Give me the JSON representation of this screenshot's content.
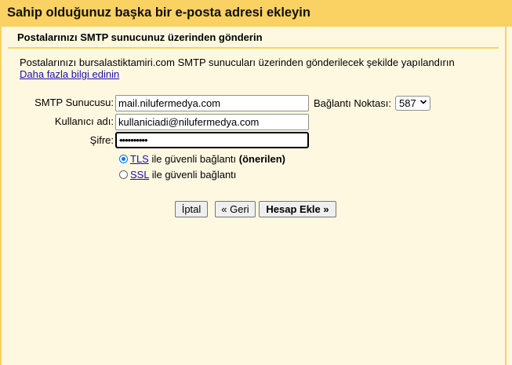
{
  "dialog": {
    "title": "Sahip olduğunuz başka bir e-posta adresi ekleyin",
    "subtitle": "Postalarınızı SMTP sunucunuz üzerinden gönderin",
    "description": "Postalarınızı bursalastiktamiri.com SMTP sunucuları üzerinden gönderilecek şekilde yapılandırın",
    "more_info_link": "Daha fazla bilgi edinin"
  },
  "form": {
    "smtp_label": "SMTP Sunucusu:",
    "smtp_value": "mail.nilufermedya.com",
    "port_label": "Bağlantı Noktası:",
    "port_value": "587",
    "username_label": "Kullanıcı adı:",
    "username_value": "kullaniciadi@nilufermedya.com",
    "password_label": "Şifre:",
    "password_value": "••••••••••"
  },
  "security": {
    "tls_link": "TLS",
    "tls_text": " ile güvenli bağlantı ",
    "tls_recommended": "(önerilen)",
    "tls_selected": true,
    "ssl_link": "SSL",
    "ssl_text": " ile güvenli bağlantı",
    "ssl_selected": false
  },
  "buttons": {
    "cancel": "İptal",
    "back": "« Geri",
    "add_account": "Hesap Ekle »"
  },
  "colors": {
    "header": "#fad163",
    "background": "#fff8e1",
    "link": "#1a0dab"
  },
  "icons": {
    "port_dropdown": "chevron-down-icon"
  }
}
